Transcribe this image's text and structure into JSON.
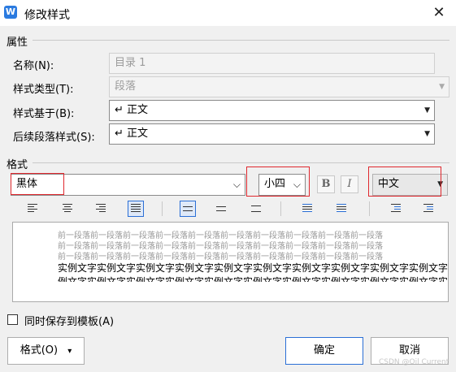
{
  "window": {
    "title": "修改样式",
    "app_icon": "W",
    "close_glyph": "✕"
  },
  "properties": {
    "section_label": "属性",
    "name_label": "名称(N):",
    "name_value": "目录 1",
    "style_type_label": "样式类型(T):",
    "style_type_value": "段落",
    "based_on_label": "样式基于(B):",
    "based_on_value": "↵ 正文",
    "next_style_label": "后续段落样式(S):",
    "next_style_value": "↵ 正文"
  },
  "format": {
    "section_label": "格式",
    "font_value": "黑体",
    "size_value": "小四",
    "bold_label": "B",
    "italic_label": "I",
    "script_value": "中文"
  },
  "preview": {
    "prev_line": "前一段落前一段落前一段落前一段落前一段落前一段落前一段落前一段落前一段落前一段落",
    "sample_line": "实例文字实例文字实例文字实例文字实例文字实例文字实例文字实例文字实例文字实例文字",
    "sample_line_2": "例文字实例文字实例文字实例文字实例文字实例文字实例文字实例文字实例文字实例文字实"
  },
  "footer": {
    "template_checkbox_label": "同时保存到模板(A)",
    "template_checked": false,
    "format_button": "格式(O)",
    "format_arrow": "▾",
    "ok_button": "确定",
    "cancel_button": "取消",
    "watermark": "CSDN @Oil Current"
  },
  "colors": {
    "accent": "#2b6fd6",
    "highlight_box": "#e0282e"
  }
}
